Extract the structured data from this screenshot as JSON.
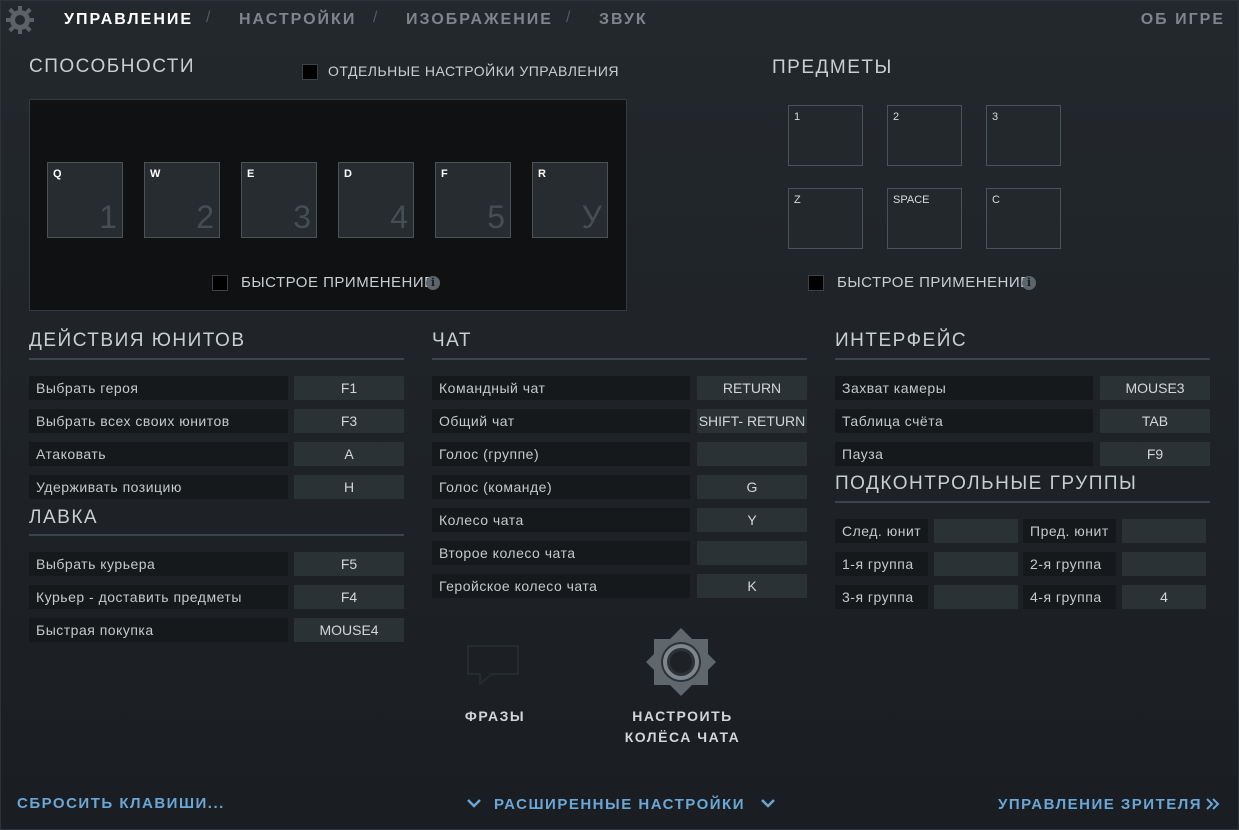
{
  "nav": {
    "tabs": [
      "УПРАВЛЕНИЕ",
      "НАСТРОЙКИ",
      "ИЗОБРАЖЕНИЕ",
      "ЗВУК"
    ],
    "separator": "/",
    "about": "ОБ ИГРЕ"
  },
  "abilities": {
    "title": "СПОСОБНОСТИ",
    "separate_settings_label": "ОТДЕЛЬНЫЕ НАСТРОЙКИ УПРАВЛЕНИЯ",
    "slots": [
      {
        "key": "Q",
        "num": "1"
      },
      {
        "key": "W",
        "num": "2"
      },
      {
        "key": "E",
        "num": "3"
      },
      {
        "key": "D",
        "num": "4"
      },
      {
        "key": "F",
        "num": "5"
      },
      {
        "key": "R",
        "num": "У"
      }
    ],
    "quick_cast_label": "БЫСТРОЕ ПРИМЕНЕНИЕ",
    "info_glyph": "i"
  },
  "items": {
    "title": "ПРЕДМЕТЫ",
    "slots": [
      "1",
      "2",
      "3",
      "Z",
      "SPACE",
      "C"
    ],
    "quick_cast_label": "БЫСТРОЕ ПРИМЕНЕНИЕ",
    "info_glyph": "i"
  },
  "unit_actions": {
    "title": "ДЕЙСТВИЯ ЮНИТОВ",
    "rows": [
      {
        "label": "Выбрать героя",
        "key": "F1"
      },
      {
        "label": "Выбрать всех своих юнитов",
        "key": "F3"
      },
      {
        "label": "Атаковать",
        "key": "A"
      },
      {
        "label": "Удерживать позицию",
        "key": "H"
      }
    ]
  },
  "shop": {
    "title": "ЛАВКА",
    "rows": [
      {
        "label": "Выбрать курьера",
        "key": "F5"
      },
      {
        "label": "Курьер - доставить предметы",
        "key": "F4"
      },
      {
        "label": "Быстрая покупка",
        "key": "MOUSE4"
      }
    ]
  },
  "chat": {
    "title": "ЧАТ",
    "rows": [
      {
        "label": "Командный чат",
        "key": "RETURN"
      },
      {
        "label": "Общий чат",
        "key": "SHIFT- RETURN"
      },
      {
        "label": "Голос (группе)",
        "key": ""
      },
      {
        "label": "Голос (команде)",
        "key": "G"
      },
      {
        "label": "Колесо чата",
        "key": "Y"
      },
      {
        "label": "Второе колесо чата",
        "key": ""
      },
      {
        "label": "Геройское колесо чата",
        "key": "K"
      }
    ]
  },
  "interface": {
    "title": "ИНТЕРФЕЙС",
    "rows": [
      {
        "label": "Захват камеры",
        "key": "MOUSE3"
      },
      {
        "label": "Таблица счёта",
        "key": "TAB"
      },
      {
        "label": "Пауза",
        "key": "F9"
      }
    ]
  },
  "control_groups": {
    "title": "ПОДКОНТРОЛЬНЫЕ ГРУППЫ",
    "cells": [
      {
        "label": "След. юнит",
        "key": ""
      },
      {
        "label": "Пред. юнит",
        "key": ""
      },
      {
        "label": "1-я группа",
        "key": ""
      },
      {
        "label": "2-я группа",
        "key": ""
      },
      {
        "label": "3-я группа",
        "key": ""
      },
      {
        "label": "4-я группа",
        "key": "4"
      }
    ]
  },
  "phrases": {
    "label": "ФРАЗЫ"
  },
  "chat_wheel_config": {
    "line1": "НАСТРОИТЬ",
    "line2": "КОЛЁСА ЧАТА"
  },
  "footer": {
    "reset": "СБРОСИТЬ КЛАВИШИ...",
    "advanced": "РАСШИРЕННЫЕ НАСТРОЙКИ",
    "spectator": "УПРАВЛЕНИЕ ЗРИТЕЛЯ"
  },
  "colors": {
    "accent_link": "#6aa6d6",
    "active_tab": "#ffffff",
    "inactive_tab": "#7d868c"
  }
}
